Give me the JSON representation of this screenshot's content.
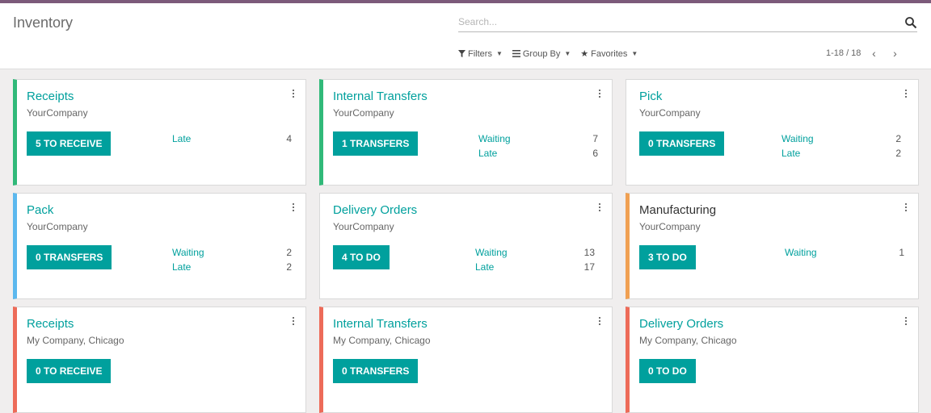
{
  "header": {
    "title": "Inventory",
    "search_placeholder": "Search...",
    "filters_label": "Filters",
    "groupby_label": "Group By",
    "favorites_label": "Favorites",
    "pager": "1-18 / 18"
  },
  "cards": [
    {
      "title": "Receipts",
      "company": "YourCompany",
      "button": "5 TO RECEIVE",
      "stats": [
        {
          "label": "Late",
          "value": "4"
        }
      ]
    },
    {
      "title": "Internal Transfers",
      "company": "YourCompany",
      "button": "1 TRANSFERS",
      "stats": [
        {
          "label": "Waiting",
          "value": "7"
        },
        {
          "label": "Late",
          "value": "6"
        }
      ]
    },
    {
      "title": "Pick",
      "company": "YourCompany",
      "button": "0 TRANSFERS",
      "stats": [
        {
          "label": "Waiting",
          "value": "2"
        },
        {
          "label": "Late",
          "value": "2"
        }
      ]
    },
    {
      "title": "Pack",
      "company": "YourCompany",
      "button": "0 TRANSFERS",
      "stats": [
        {
          "label": "Waiting",
          "value": "2"
        },
        {
          "label": "Late",
          "value": "2"
        }
      ]
    },
    {
      "title": "Delivery Orders",
      "company": "YourCompany",
      "button": "4 TO DO",
      "stats": [
        {
          "label": "Waiting",
          "value": "13"
        },
        {
          "label": "Late",
          "value": "17"
        }
      ]
    },
    {
      "title": "Manufacturing",
      "company": "YourCompany",
      "button": "3 TO DO",
      "stats": [
        {
          "label": "Waiting",
          "value": "1"
        }
      ]
    },
    {
      "title": "Receipts",
      "company": "My Company, Chicago",
      "button": "0 TO RECEIVE",
      "stats": []
    },
    {
      "title": "Internal Transfers",
      "company": "My Company, Chicago",
      "button": "0 TRANSFERS",
      "stats": []
    },
    {
      "title": "Delivery Orders",
      "company": "My Company, Chicago",
      "button": "0 TO DO",
      "stats": []
    }
  ],
  "colors": {
    "brand_bar": "#7c5a7a",
    "accent": "#00a09d",
    "green": "#31b979",
    "blue": "#5cb8ee",
    "orange": "#f0a052",
    "red": "#ed6b59"
  },
  "icons": {
    "search": "search-icon",
    "filter": "filter-icon",
    "groupby": "list-icon",
    "favorites": "star-icon",
    "pager_prev": "chevron-left-icon",
    "pager_next": "chevron-right-icon",
    "card_menu": "kebab-menu-icon"
  }
}
